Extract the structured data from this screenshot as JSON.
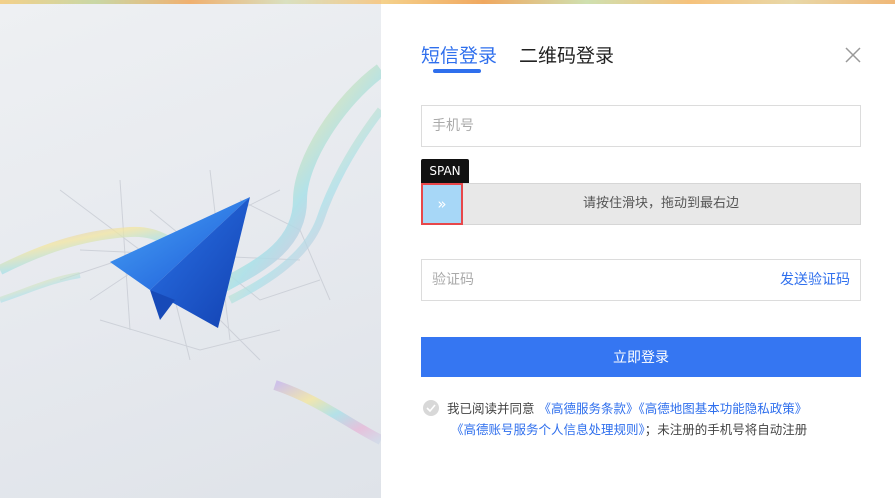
{
  "tabs": [
    {
      "label": "短信登录",
      "active": true
    },
    {
      "label": "二维码登录",
      "active": false
    }
  ],
  "phone": {
    "placeholder": "手机号",
    "value": ""
  },
  "debug_tag": "SPAN",
  "slider": {
    "text": "请按住滑块，拖动到最右边",
    "handle_glyph": "»"
  },
  "code": {
    "placeholder": "验证码",
    "send_label": "发送验证码"
  },
  "login_button": "立即登录",
  "agreement": {
    "prefix": "我已阅读并同意",
    "link1": "《高德服务条款》",
    "link2": "《高德地图基本功能隐私政策》",
    "link3": "《高德账号服务个人信息处理规则》",
    "suffix": "；未注册的手机号将自动注册"
  },
  "colors": {
    "accent": "#2f6fed",
    "button": "#3576f2",
    "handle": "#a7d7f7",
    "handle_border": "#e8474a"
  }
}
